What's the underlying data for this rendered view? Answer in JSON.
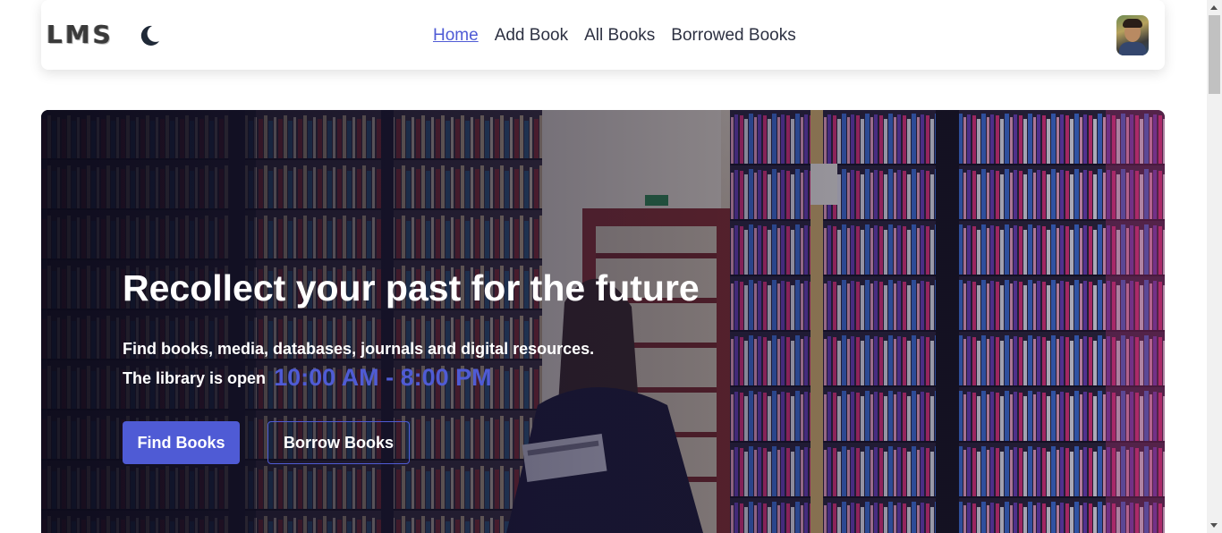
{
  "navbar": {
    "logo": "LMS",
    "theme_toggle_icon": "moon-icon",
    "links": [
      {
        "label": "Home",
        "active": true
      },
      {
        "label": "Add Book",
        "active": false
      },
      {
        "label": "All Books",
        "active": false
      },
      {
        "label": "Borrowed Books",
        "active": false
      }
    ],
    "avatar_icon": "user-avatar"
  },
  "hero": {
    "title": "Recollect your past for the future",
    "subtitle": "Find books, media, databases, journals and digital resources.",
    "open_label": "The library is open",
    "hours": "10:00 AM - 8:00 PM",
    "primary_button": "Find Books",
    "secondary_button": "Borrow Books"
  },
  "colors": {
    "accent": "#4f5bd5",
    "nav_text": "#2d3142",
    "hero_text": "#ffffff"
  }
}
